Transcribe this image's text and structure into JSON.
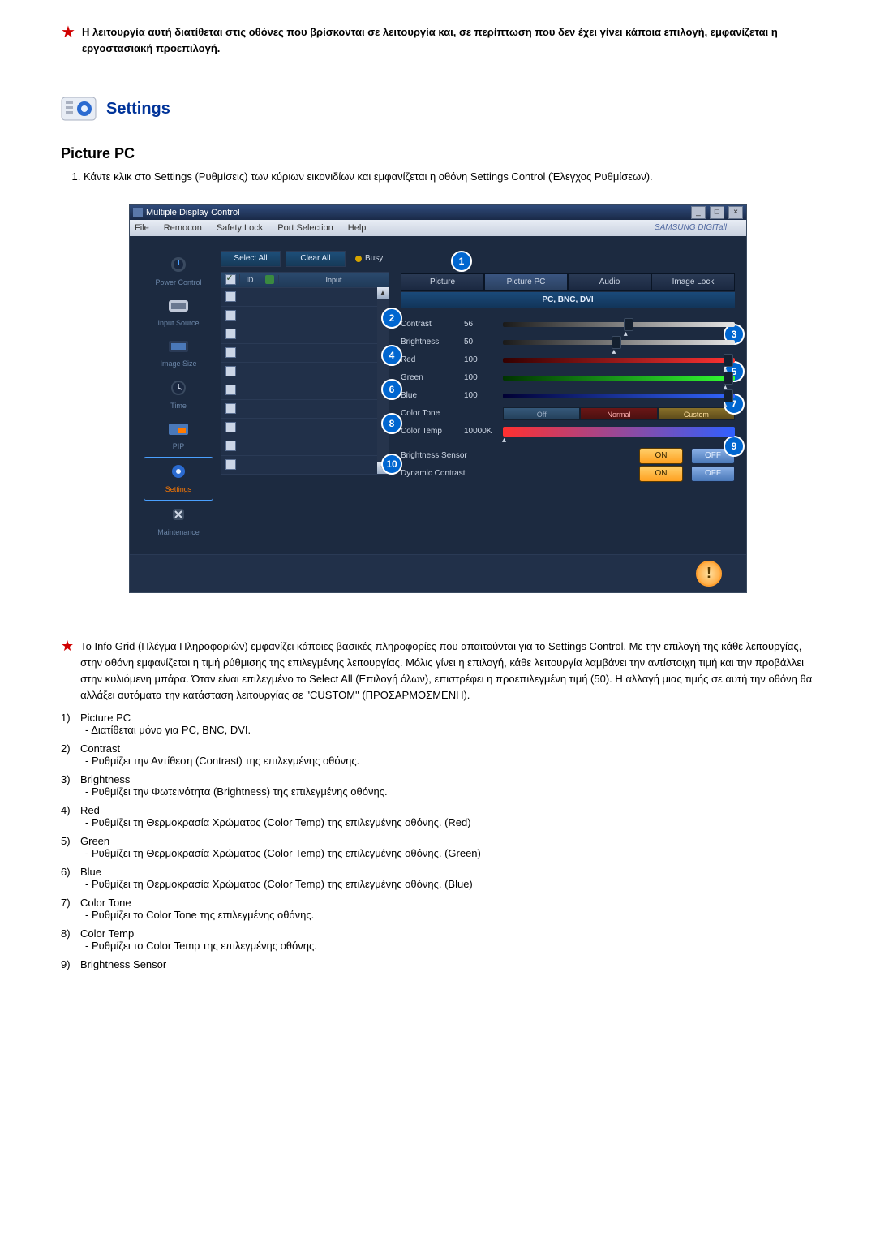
{
  "top_note": "Η λειτουργία αυτή διατίθεται στις οθόνες που βρίσκονται σε λειτουργία και, σε περίπτωση που δεν έχει γίνει κάποια επιλογή, εμφανίζεται η εργοστασιακή προεπιλογή.",
  "settings": {
    "heading": "Settings",
    "subheading": "Picture PC",
    "instruction": "Κάντε κλικ στο Settings (Ρυθμίσεις) των κύριων εικονιδίων και εμφανίζεται η οθόνη Settings Control (Έλεγχος Ρυθμίσεων)."
  },
  "app": {
    "title": "Multiple Display Control",
    "win_min": "_",
    "win_max": "□",
    "win_close": "×",
    "menu": [
      "File",
      "Remocon",
      "Safety Lock",
      "Port Selection",
      "Help"
    ],
    "brand": "SAMSUNG DIGITall",
    "sidebar": [
      {
        "label": "Power Control"
      },
      {
        "label": "Input Source"
      },
      {
        "label": "Image Size"
      },
      {
        "label": "Time"
      },
      {
        "label": "PIP"
      },
      {
        "label": "Settings"
      },
      {
        "label": "Maintenance"
      }
    ],
    "select_all": "Select All",
    "clear_all": "Clear All",
    "busy": "Busy",
    "grid": {
      "col_id": "ID",
      "col_input": "Input",
      "rows": 10
    },
    "tabs": [
      {
        "label": "Picture"
      },
      {
        "label": "Picture PC"
      },
      {
        "label": "Audio"
      },
      {
        "label": "Image Lock"
      }
    ],
    "source_title": "PC, BNC, DVI",
    "rows": {
      "contrast": {
        "label": "Contrast",
        "value": "56"
      },
      "brightness": {
        "label": "Brightness",
        "value": "50"
      },
      "red": {
        "label": "Red",
        "value": "100"
      },
      "green": {
        "label": "Green",
        "value": "100"
      },
      "blue": {
        "label": "Blue",
        "value": "100"
      },
      "color_tone": {
        "label": "Color Tone"
      },
      "tone_off": "Off",
      "tone_normal": "Normal",
      "tone_custom": "Custom",
      "color_temp": {
        "label": "Color Temp",
        "value": "10000K"
      },
      "brightness_sensor": {
        "label": "Brightness Sensor"
      },
      "dynamic_contrast": {
        "label": "Dynamic Contrast"
      },
      "on": "ON",
      "off": "OFF"
    },
    "callouts": [
      "1",
      "2",
      "3",
      "4",
      "5",
      "6",
      "7",
      "8",
      "9",
      "10"
    ]
  },
  "info_paragraph": "Το Info Grid (Πλέγμα Πληροφοριών) εμφανίζει κάποιες βασικές πληροφορίες που απαιτούνται για το Settings Control. Με την επιλογή της κάθε λειτουργίας, στην οθόνη εμφανίζεται η τιμή ρύθμισης της επιλεγμένης λειτουργίας. Μόλις γίνει η επιλογή, κάθε λειτουργία λαμβάνει την αντίστοιχη τιμή και την προβάλλει στην κυλιόμενη μπάρα. Όταν είναι επιλεγμένο το Select All (Επιλογή όλων), επιστρέφει η προεπιλεγμένη τιμή (50). Η αλλαγή μιας τιμής σε αυτή την οθόνη θα αλλάξει αυτόματα την κατάσταση λειτουργίας σε \"CUSTOM\" (ΠΡΟΣΑΡΜΟΣΜΕΝΗ).",
  "list": [
    {
      "num": "1)",
      "title": "Picture PC",
      "desc": "- Διατίθεται μόνο για PC, BNC, DVI."
    },
    {
      "num": "2)",
      "title": "Contrast",
      "desc": "- Ρυθμίζει την Αντίθεση (Contrast) της επιλεγμένης οθόνης."
    },
    {
      "num": "3)",
      "title": "Brightness",
      "desc": "- Ρυθμίζει την Φωτεινότητα (Brightness) της επιλεγμένης οθόνης."
    },
    {
      "num": "4)",
      "title": "Red",
      "desc": "- Ρυθμίζει τη Θερμοκρασία Χρώματος (Color Temp) της επιλεγμένης οθόνης. (Red)"
    },
    {
      "num": "5)",
      "title": "Green",
      "desc": "- Ρυθμίζει τη Θερμοκρασία Χρώματος (Color Temp) της επιλεγμένης οθόνης. (Green)"
    },
    {
      "num": "6)",
      "title": "Blue",
      "desc": "- Ρυθμίζει τη Θερμοκρασία Χρώματος (Color Temp) της επιλεγμένης οθόνης. (Blue)"
    },
    {
      "num": "7)",
      "title": "Color Tone",
      "desc": "- Ρυθμίζει το Color Tone της επιλεγμένης οθόνης."
    },
    {
      "num": "8)",
      "title": "Color Temp",
      "desc": "- Ρυθμίζει το Color Temp της επιλεγμένης οθόνης."
    },
    {
      "num": "9)",
      "title": "Brightness Sensor",
      "desc": ""
    }
  ]
}
